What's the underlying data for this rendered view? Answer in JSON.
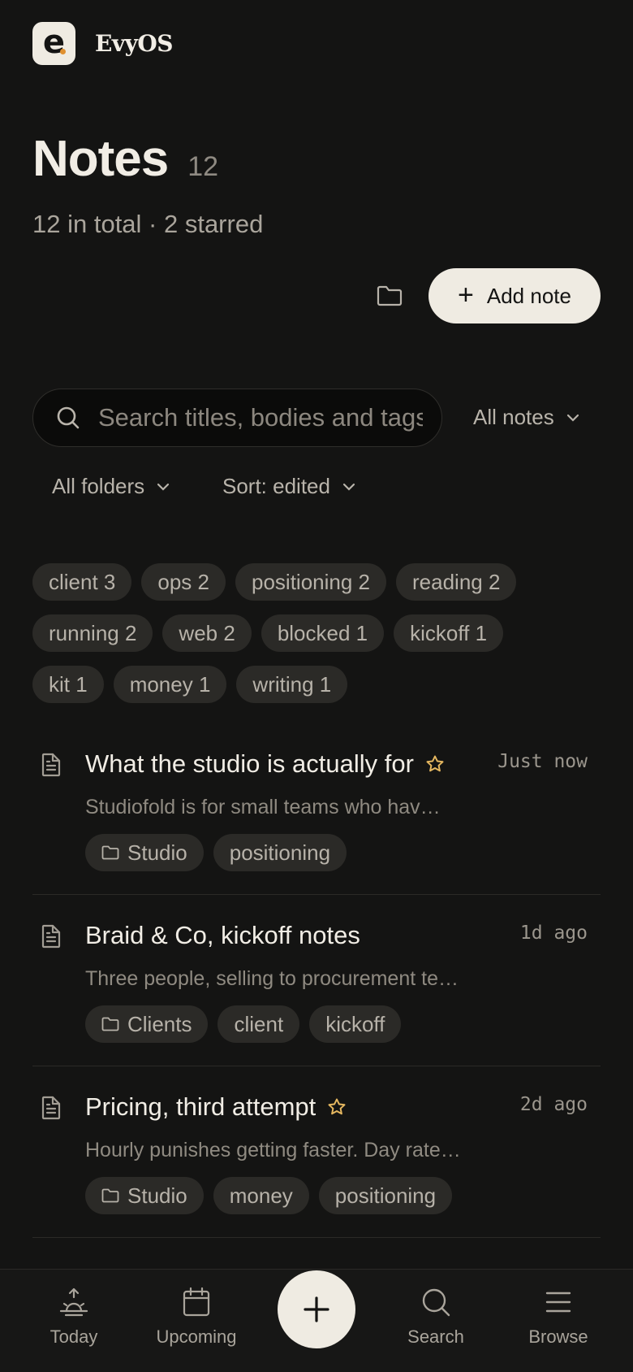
{
  "app": {
    "name": "EvyOS",
    "logo_letter": "e",
    "accent": "#e0902f"
  },
  "header": {
    "title": "Notes",
    "count": "12",
    "subtitle": "12 in total · 2 starred"
  },
  "actions": {
    "folder_icon": "folder-icon",
    "add_label": "Add note"
  },
  "search": {
    "placeholder": "Search titles, bodies and tags"
  },
  "filters": {
    "scope": "All notes",
    "folders": "All folders",
    "sort": "Sort: edited"
  },
  "tags": [
    [
      "client 3",
      "ops 2",
      "positioning 2",
      "reading 2"
    ],
    [
      "running 2",
      "web 2",
      "blocked 1",
      "kickoff 1"
    ],
    [
      "kit 1",
      "money 1",
      "writing 1"
    ]
  ],
  "notes": [
    {
      "title": "What the studio is actually for",
      "starred": true,
      "time": "Just now",
      "excerpt": "Studiofold is for small teams who hav…",
      "folder": "Studio",
      "tags": [
        "positioning"
      ]
    },
    {
      "title": "Braid & Co, kickoff notes",
      "starred": false,
      "time": "1d ago",
      "excerpt": "Three people, selling to procurement te…",
      "folder": "Clients",
      "tags": [
        "client",
        "kickoff"
      ]
    },
    {
      "title": "Pricing, third attempt",
      "starred": true,
      "time": "2d ago",
      "excerpt": "Hourly punishes getting faster. Day rate…",
      "folder": "Studio",
      "tags": [
        "money",
        "positioning"
      ]
    }
  ],
  "nav": {
    "today": "Today",
    "upcoming": "Upcoming",
    "search": "Search",
    "browse": "Browse",
    "fab_icon": "plus-icon"
  },
  "colors": {
    "background": "#141413",
    "chip": "#2b2a27",
    "star": "#e6b860",
    "button": "#efebe2"
  }
}
